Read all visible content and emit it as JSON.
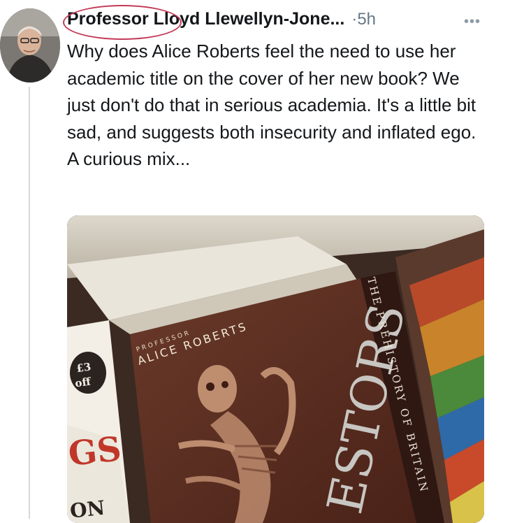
{
  "tweet": {
    "author_name": "Professor Lloyd Llewellyn-Jone...",
    "time": "·5h",
    "more_icon": "more-horizontal-icon",
    "text": "Why does Alice Roberts feel the need to use her academic title on the cover of her new book? We just don't do that in serious academia. It's a little bit sad, and suggests both insecurity and inflated ego. A curious mix...",
    "highlight_color": "#c43a57"
  },
  "photo": {
    "price_sticker": [
      "£3",
      "off"
    ],
    "left_book_letters": "GS",
    "left_book_letters_2": "ON",
    "cover_kicker": "PROFESSOR",
    "cover_author": "ALICE ROBERTS",
    "cover_title_fragment": "ESTORS",
    "spine_text": "THE PREHISTORY OF BRITAIN"
  }
}
